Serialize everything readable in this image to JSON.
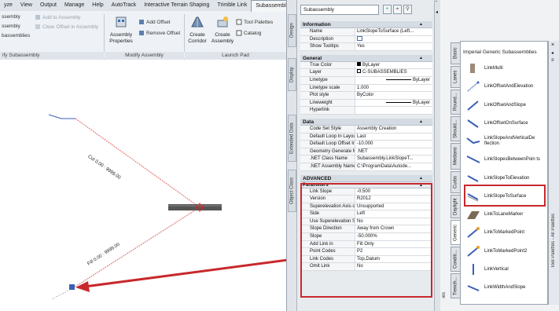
{
  "ribbon": {
    "tabs": [
      "yze",
      "View",
      "Output",
      "Manage",
      "Help",
      "AutoTrack",
      "Interactive Terrain Shaping",
      "Trimble Link",
      "Subassembly"
    ],
    "commands": {
      "add_to_assembly": "Add to Assembly",
      "clear_offset": "Clear Offset in Assembly",
      "assembly_left": "ssembly",
      "subassemblies": "bassemblies",
      "assembly_properties": "Assembly Properties",
      "add_offset": "Add Offset",
      "remove_offset": "Remove Offset",
      "create_corridor": "Create Corridor",
      "create_assembly": "Create Assembly",
      "tool_palettes": "Tool Palettes",
      "catalog": "Catalog"
    },
    "panels": {
      "modify_subassembly": "ify Subassembly",
      "modify_assembly": "Modify Assembly",
      "launch_pad": "Launch Pad"
    }
  },
  "drawing": {
    "cut_label": "Cut 0.00 : 9999.00",
    "fill_label": "Fill 0.00 : 9999.00"
  },
  "properties": {
    "selector": "Subassembly",
    "side_tabs": [
      "Design",
      "Display",
      "Extended Data",
      "Object Class"
    ],
    "categories": [
      {
        "name": "Information",
        "rows": [
          {
            "k": "Name",
            "v": "LinkSlopeToSurface (Left..."
          },
          {
            "k": "Description",
            "v": ""
          },
          {
            "k": "Show Tooltips",
            "v": "Yes"
          }
        ]
      },
      {
        "name": "General",
        "rows": [
          {
            "k": "True Color",
            "v": "ByLayer"
          },
          {
            "k": "Layer",
            "v": "C-SUBASSEMBLIES"
          },
          {
            "k": "Linetype",
            "v": "ByLayer"
          },
          {
            "k": "Linetype scale",
            "v": "1.000"
          },
          {
            "k": "Plot style",
            "v": "ByColor"
          },
          {
            "k": "Lineweight",
            "v": "ByLayer"
          },
          {
            "k": "Hyperlink",
            "v": ""
          }
        ]
      },
      {
        "name": "Data",
        "rows": [
          {
            "k": "Code Set Style",
            "v": "Assembly Creation"
          },
          {
            "k": "Default Loop In Layou...",
            "v": "Last"
          },
          {
            "k": "Default Loop Offset In...",
            "v": "-10.000"
          },
          {
            "k": "Geometry Generate M...",
            "v": ".NET"
          },
          {
            "k": ".NET Class Name",
            "v": "Subassembly.LinkSlopeT..."
          },
          {
            "k": ".NET Assembly Name",
            "v": "C:\\ProgramData\\Autode..."
          }
        ]
      }
    ],
    "advanced": {
      "name": "ADVANCED",
      "sub": "Parameters",
      "rows": [
        {
          "k": "Link Slope",
          "v": "-0.500"
        },
        {
          "k": "Version",
          "v": "R2012"
        },
        {
          "k": "Superelevation Axis of...",
          "v": "Unsupported"
        },
        {
          "k": "Side",
          "v": "Left"
        },
        {
          "k": "Use Superelevation Sl...",
          "v": "No"
        },
        {
          "k": "Slope Direction",
          "v": "Away from Crown"
        },
        {
          "k": "Slope",
          "v": "-50.000%"
        },
        {
          "k": "Add Link in",
          "v": "Fill Only"
        },
        {
          "k": "Point Codes",
          "v": "P2"
        },
        {
          "k": "Link Codes",
          "v": "Top,Datum"
        },
        {
          "k": "Omit Link",
          "v": "No"
        }
      ]
    }
  },
  "palette": {
    "title": "Imperial Generic Subassemblies",
    "tabs": [
      "Basic",
      "Lanes",
      "Round...",
      "Should...",
      "Medians",
      "Curbs",
      "Daylight",
      "Generic",
      "Conditi...",
      "Trench..."
    ],
    "right_label": "Tool Palettes - All Palettes",
    "items": [
      {
        "label": "LinkMulti",
        "icon": "link-multi-icon"
      },
      {
        "label": "LinkOffsetAndElevation",
        "icon": "link-offset-elevation-icon"
      },
      {
        "label": "LinkOffsetAndSlope",
        "icon": "link-offset-slope-icon"
      },
      {
        "label": "LinkOffsetOnSurface",
        "icon": "link-offset-surface-icon"
      },
      {
        "label": "LinkSlopeAndVerticalDe flection",
        "icon": "link-slope-vertical-icon"
      },
      {
        "label": "LinkSlopesBetweenPoin ts",
        "icon": "link-slopes-between-icon"
      },
      {
        "label": "LinkSlopeToElevation",
        "icon": "link-slope-elevation-icon"
      },
      {
        "label": "LinkSlopeToSurface",
        "icon": "link-slope-surface-icon"
      },
      {
        "label": "LinkToLaneMarker",
        "icon": "link-lane-marker-icon"
      },
      {
        "label": "LinkToMarkedPoint",
        "icon": "link-marked-point-icon"
      },
      {
        "label": "LinkToMarkedPoint2",
        "icon": "link-marked-point2-icon"
      },
      {
        "label": "LinkVertical",
        "icon": "link-vertical-icon"
      },
      {
        "label": "LinkWidthAndSlope",
        "icon": "link-width-slope-icon"
      }
    ],
    "left_strip_label": "ies"
  },
  "colors": {
    "highlight": "#c8282c",
    "cut_line": "#e46a6a",
    "link_blue": "#3a5fb5"
  }
}
